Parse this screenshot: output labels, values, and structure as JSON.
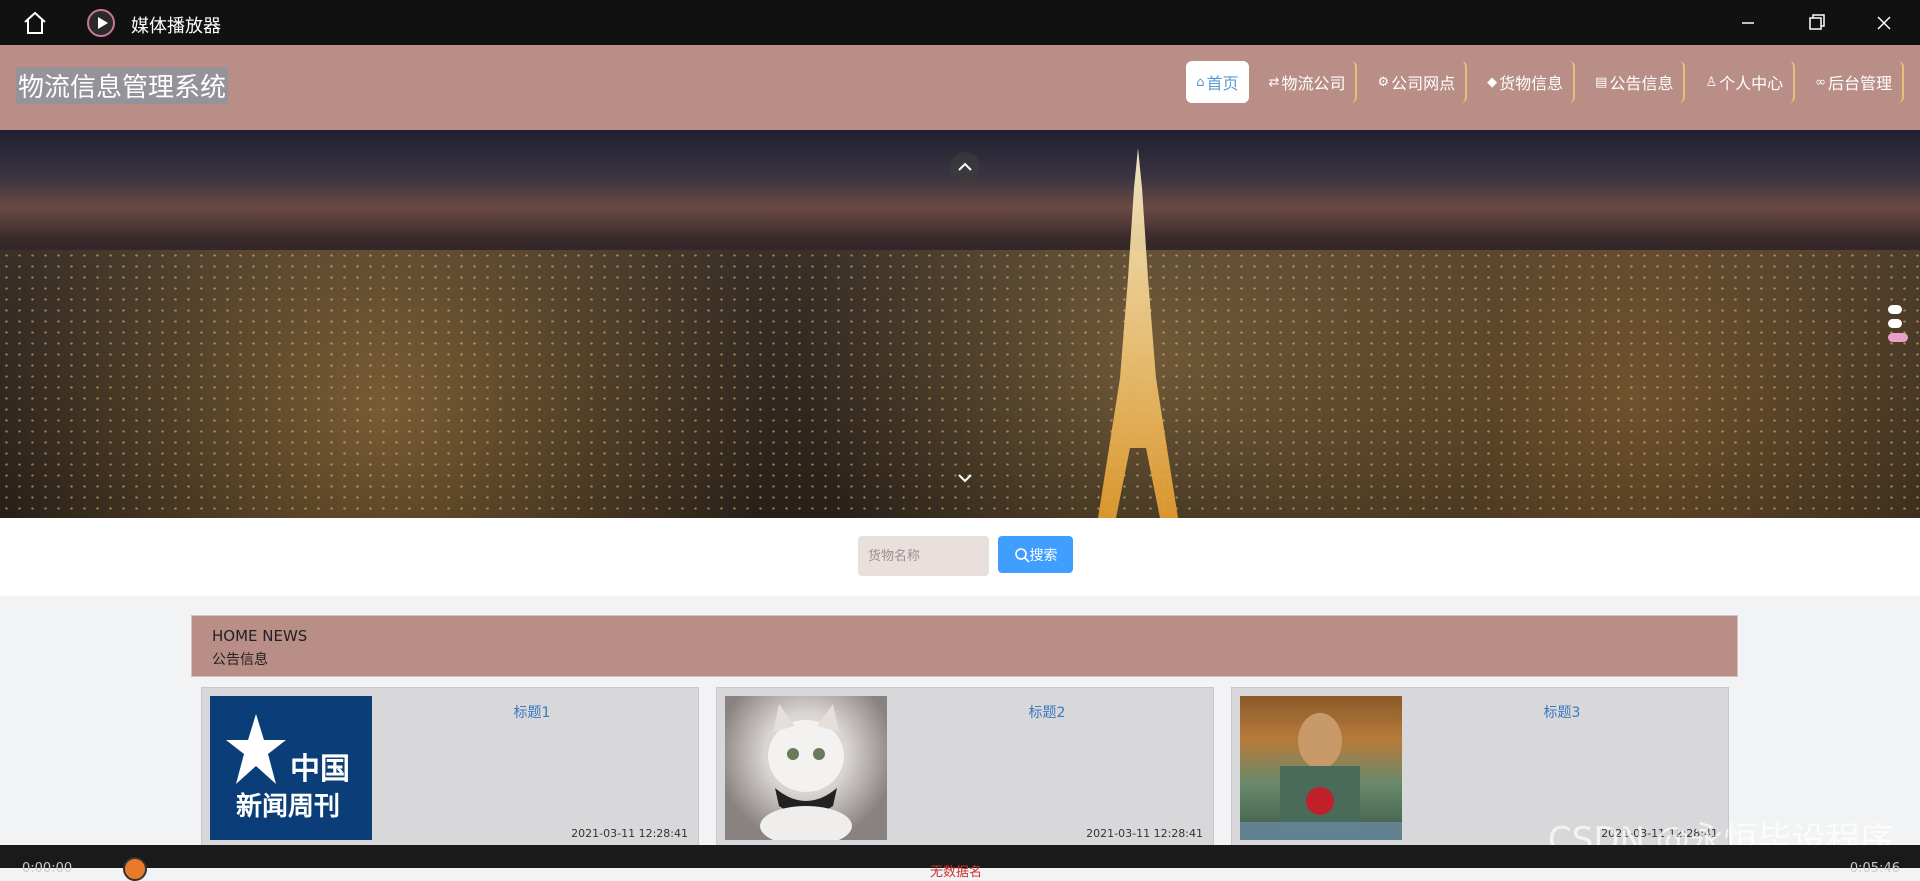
{
  "titlebar": {
    "app_title": "媒体播放器",
    "icons": [
      "home-icon",
      "media-player-logo-icon",
      "minimize-icon",
      "restore-icon",
      "close-icon"
    ]
  },
  "header": {
    "site_title": "物流信息管理系统",
    "nav": [
      {
        "label": "首页",
        "icon": "home-icon",
        "active": true
      },
      {
        "label": "物流公司",
        "icon": "transfer-icon"
      },
      {
        "label": "公司网点",
        "icon": "network-icon"
      },
      {
        "label": "货物信息",
        "icon": "cap-icon"
      },
      {
        "label": "公告信息",
        "icon": "document-icon"
      },
      {
        "label": "个人中心",
        "icon": "user-icon"
      },
      {
        "label": "后台管理",
        "icon": "link-icon"
      }
    ]
  },
  "carousel": {
    "slide_count": 3,
    "active_index": 2
  },
  "search": {
    "placeholder": "货物名称",
    "button_label": "搜索"
  },
  "news": {
    "heading_en": "HOME NEWS",
    "heading_cn": "公告信息",
    "items": [
      {
        "title": "标题1",
        "date": "2021-03-11 12:28:41",
        "thumb_text_1": "中国",
        "thumb_text_2": "新闻周刊"
      },
      {
        "title": "标题2",
        "date": "2021-03-11 12:28:41"
      },
      {
        "title": "标题3",
        "date": "2021-03-11 12:28:41"
      }
    ]
  },
  "watermark": "CSDN @永恒毕设程序",
  "player": {
    "time_left": "0:00:00",
    "time_right": "0:05:46",
    "center_text": "无数据名"
  },
  "colors": {
    "header_bg": "#b88e87",
    "search_button": "#409eff",
    "nav_border": "#e6c07a",
    "carousel_active_dot": "#e8a0c8"
  }
}
